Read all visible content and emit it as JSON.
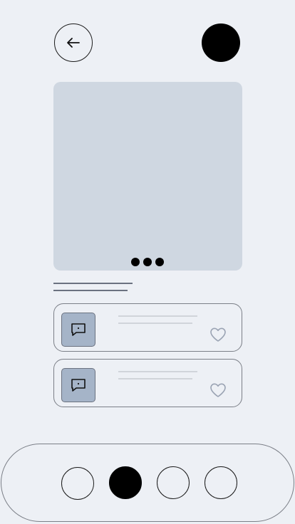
{
  "header": {
    "back_icon": "arrow-left-icon",
    "avatar_color": "#000000"
  },
  "hero": {
    "image_color": "#cfd7e1",
    "carousel_dots": 3
  },
  "cards": [
    {
      "icon": "chat-bubble-icon",
      "like_icon": "heart-outline-icon"
    },
    {
      "icon": "chat-bubble-icon",
      "like_icon": "heart-outline-icon"
    }
  ],
  "bottom_nav": {
    "items": 4,
    "active_index": 1
  },
  "colors": {
    "background": "#edf0f5",
    "thumb": "#a5b4c8",
    "outline": "#7b7f87",
    "heart": "#9aa3b3"
  }
}
